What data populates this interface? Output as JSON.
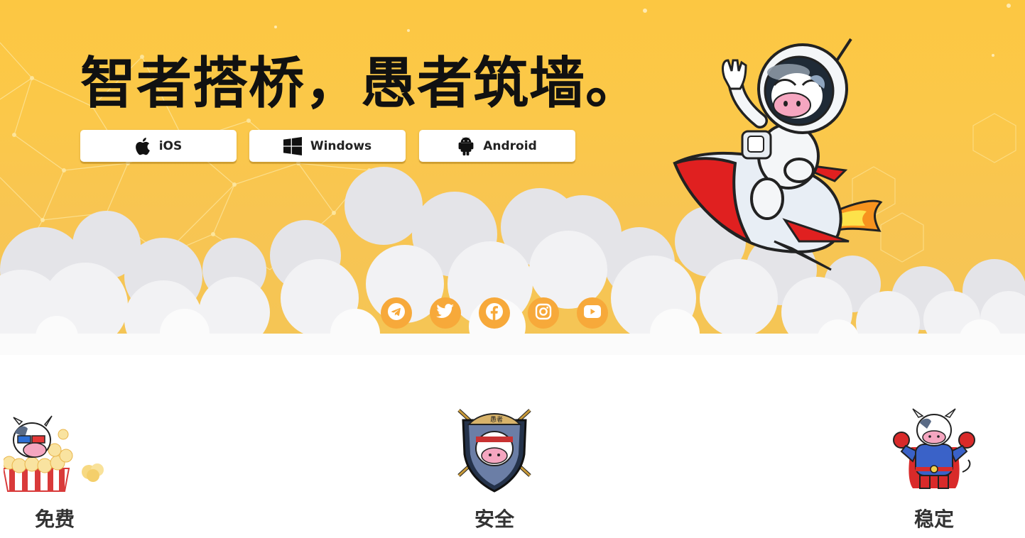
{
  "hero": {
    "headline": "智者搭桥，愚者筑墙。",
    "background_color": "#fbc84a",
    "downloads": [
      {
        "label": "iOS",
        "icon": "apple-icon"
      },
      {
        "label": "Windows",
        "icon": "windows-icon"
      },
      {
        "label": "Android",
        "icon": "android-icon"
      }
    ],
    "social": [
      {
        "icon": "telegram-icon"
      },
      {
        "icon": "twitter-icon"
      },
      {
        "icon": "facebook-icon"
      },
      {
        "icon": "instagram-icon"
      },
      {
        "icon": "youtube-icon"
      }
    ],
    "social_color": "#f7a93a"
  },
  "features": [
    {
      "title": "免费",
      "icon": "cow-popcorn-icon"
    },
    {
      "title": "安全",
      "icon": "cow-shield-icon"
    },
    {
      "title": "稳定",
      "icon": "cow-superhero-icon"
    }
  ]
}
